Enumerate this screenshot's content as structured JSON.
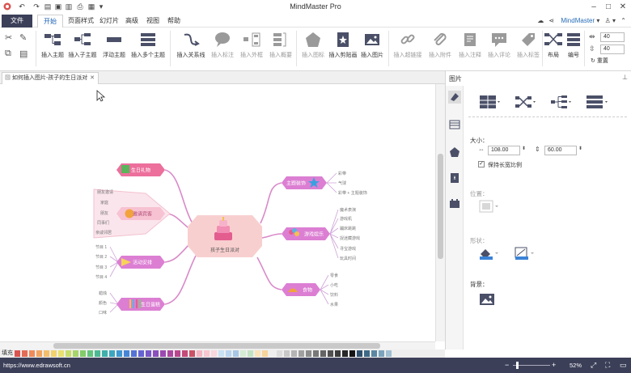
{
  "app": {
    "title": "MindMaster Pro"
  },
  "menu": {
    "file": "文件",
    "tabs": [
      "开始",
      "页面样式",
      "幻灯片",
      "高级",
      "视图",
      "帮助"
    ],
    "account": "MindMaster"
  },
  "ribbon": {
    "buttons": [
      {
        "label": "插入主题",
        "enabled": true
      },
      {
        "label": "插入子主题",
        "enabled": true
      },
      {
        "label": "浮动主题",
        "enabled": true
      },
      {
        "label": "插入多个主题",
        "enabled": true
      },
      {
        "label": "插入关系线",
        "enabled": true
      },
      {
        "label": "插入标注",
        "enabled": false
      },
      {
        "label": "插入外框",
        "enabled": false
      },
      {
        "label": "插入概要",
        "enabled": false
      },
      {
        "label": "插入图标",
        "enabled": false
      },
      {
        "label": "插入剪贴画",
        "enabled": true
      },
      {
        "label": "插入图片",
        "enabled": true
      },
      {
        "label": "插入超链接",
        "enabled": false
      },
      {
        "label": "插入附件",
        "enabled": false
      },
      {
        "label": "插入注释",
        "enabled": false
      },
      {
        "label": "插入评论",
        "enabled": false
      },
      {
        "label": "插入标签",
        "enabled": false
      },
      {
        "label": "布局",
        "enabled": true
      },
      {
        "label": "编号",
        "enabled": true
      }
    ],
    "spin1": "40",
    "spin2": "40",
    "reset": "重置"
  },
  "document": {
    "tab_title": "如何插入图片-孩子的生日派对"
  },
  "panel": {
    "title": "图片",
    "size_label": "大小：",
    "width": "108.00",
    "height": "60.00",
    "keep_ratio": "保持长宽比例",
    "position_label": "位置：",
    "shape_label": "形状：",
    "background_label": "背景："
  },
  "mindmap": {
    "center": "孩子生日派对",
    "branches": [
      {
        "label": "生日礼物",
        "children": []
      },
      {
        "label": "邀请宾客",
        "children": [
          "朋友邀请",
          "家庭",
          "朋友",
          "同事们",
          "亲戚邻居"
        ]
      },
      {
        "label": "活动安排",
        "children": [
          "节目 1",
          "节目 2",
          "节目 3",
          "节目 4"
        ]
      },
      {
        "label": "生日蛋糕",
        "children": [
          "蜡烛",
          "颜色",
          "口味"
        ]
      },
      {
        "label": "主题装饰",
        "children": [
          "彩带",
          "气球",
          "彩带 + 主题装饰"
        ]
      },
      {
        "label": "游戏娱乐",
        "children": [
          "魔术表演",
          "游戏机",
          "蹦床跳跳",
          "捉迷藏游戏",
          "寻宝游戏",
          "玩具时间"
        ]
      },
      {
        "label": "食物",
        "children": [
          "零食",
          "小吃",
          "饮料",
          "水果"
        ]
      }
    ]
  },
  "status": {
    "url": "https://www.edrawsoft.cn",
    "zoom": "52%",
    "fill_label": "填充"
  },
  "colors": {
    "accent": "#3b3f58",
    "link": "#1a5fb4",
    "pink": "#e35d8f",
    "purple": "#c76ed6",
    "center": "#f6c9c9",
    "branch_line": "#d07ac8"
  },
  "palette": [
    "#d9534f",
    "#e36b55",
    "#ef8a5a",
    "#f1a35f",
    "#f5bd6b",
    "#f2d26c",
    "#e8e06f",
    "#c8dc6a",
    "#a6d56a",
    "#82cc6a",
    "#62c47d",
    "#4bb994",
    "#3fb0ab",
    "#3ba6c0",
    "#3e97d0",
    "#4685d6",
    "#5473d6",
    "#6563d1",
    "#7758c8",
    "#8a50bd",
    "#9b4bb0",
    "#ab479f",
    "#b9468d",
    "#c44a79",
    "#cc5166",
    "#f4b4c2",
    "#f7c6d0",
    "#fad6dd",
    "#c8e1f5",
    "#b8d4ee",
    "#a7c7e6",
    "#d5ecd4",
    "#c3e2c2",
    "#fbe3b8",
    "#f7d49b",
    "#efeeee",
    "#dcdcdc",
    "#c8c8c8",
    "#b4b4b4",
    "#a0a0a0",
    "#8c8c8c",
    "#787878",
    "#646464",
    "#505050",
    "#3c3c3c",
    "#282828",
    "#141414",
    "#2f4f6f",
    "#3f6a87",
    "#5b87a3",
    "#7ba3bb",
    "#a0bfd1"
  ]
}
